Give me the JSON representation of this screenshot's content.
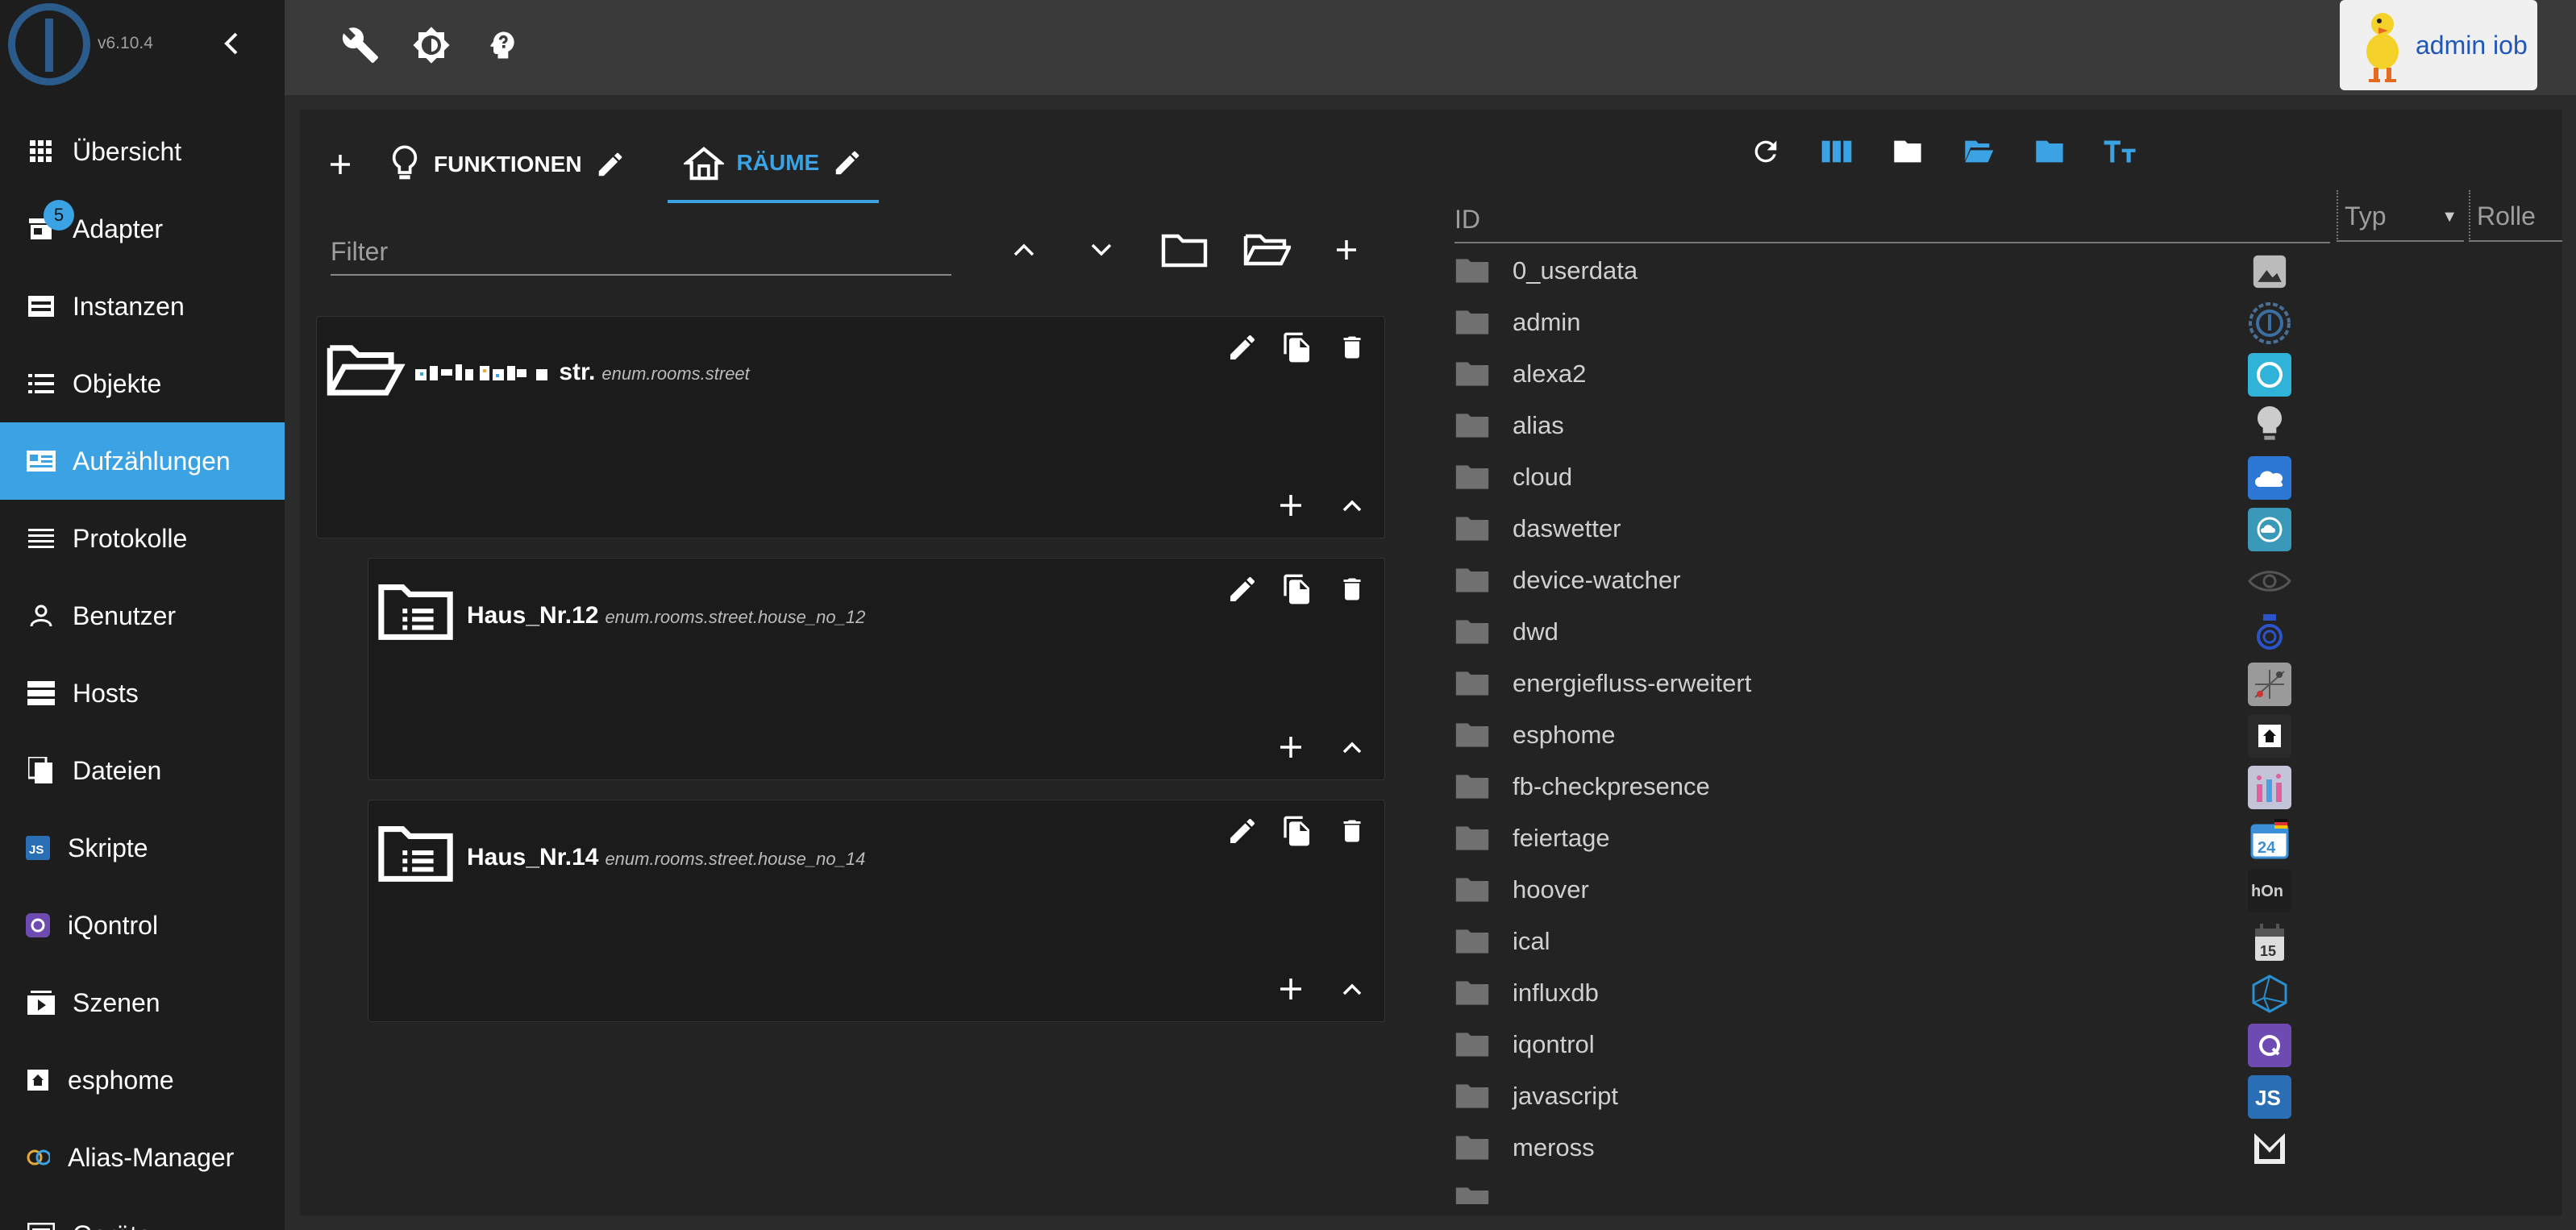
{
  "app": {
    "version": "v6.10.4"
  },
  "user": {
    "name": "admin iob"
  },
  "sidebar": {
    "items": [
      {
        "label": "Übersicht",
        "icon": "grid-icon"
      },
      {
        "label": "Adapter",
        "icon": "store-icon",
        "badge": "5"
      },
      {
        "label": "Instanzen",
        "icon": "instances-icon"
      },
      {
        "label": "Objekte",
        "icon": "list-icon"
      },
      {
        "label": "Aufzählungen",
        "icon": "enum-icon",
        "active": true
      },
      {
        "label": "Protokolle",
        "icon": "logs-icon"
      },
      {
        "label": "Benutzer",
        "icon": "person-icon"
      },
      {
        "label": "Hosts",
        "icon": "hosts-icon"
      },
      {
        "label": "Dateien",
        "icon": "files-icon"
      },
      {
        "label": "Skripte",
        "icon": "js-icon"
      },
      {
        "label": "iQontrol",
        "icon": "iqontrol-icon"
      },
      {
        "label": "Szenen",
        "icon": "scenes-icon"
      },
      {
        "label": "esphome",
        "icon": "esphome-icon"
      },
      {
        "label": "Alias-Manager",
        "icon": "alias-icon"
      },
      {
        "label": "Geräte",
        "icon": "devices-icon"
      }
    ]
  },
  "tabs": [
    {
      "label": "FUNKTIONEN"
    },
    {
      "label": "RÄUME",
      "active": true
    }
  ],
  "filter": {
    "placeholder": "Filter"
  },
  "cards": [
    {
      "title": "str.",
      "id": "enum.rooms.street"
    },
    {
      "title": "Haus_Nr.12",
      "id": "enum.rooms.street.house_no_12"
    },
    {
      "title": "Haus_Nr.14",
      "id": "enum.rooms.street.house_no_14"
    }
  ],
  "objects": {
    "columns": {
      "id": "ID",
      "type": "Typ",
      "role": "Rolle"
    },
    "rows": [
      {
        "name": "0_userdata",
        "icon": "image-icon"
      },
      {
        "name": "admin",
        "icon": "admin-icon"
      },
      {
        "name": "alexa2",
        "icon": "alexa-icon"
      },
      {
        "name": "alias",
        "icon": "bulb-icon"
      },
      {
        "name": "cloud",
        "icon": "cloud-icon"
      },
      {
        "name": "daswetter",
        "icon": "weather-icon"
      },
      {
        "name": "device-watcher",
        "icon": "eye-icon"
      },
      {
        "name": "dwd",
        "icon": "dwd-icon"
      },
      {
        "name": "energiefluss-erweitert",
        "icon": "energy-icon"
      },
      {
        "name": "esphome",
        "icon": "esphome-icon"
      },
      {
        "name": "fb-checkpresence",
        "icon": "presence-icon"
      },
      {
        "name": "feiertage",
        "icon": "calendar-24-icon"
      },
      {
        "name": "hoover",
        "icon": "hon-icon"
      },
      {
        "name": "ical",
        "icon": "calendar-15-icon"
      },
      {
        "name": "influxdb",
        "icon": "influx-icon"
      },
      {
        "name": "iqontrol",
        "icon": "iqontrol-icon"
      },
      {
        "name": "javascript",
        "icon": "js-icon"
      },
      {
        "name": "meross",
        "icon": "meross-icon"
      }
    ]
  },
  "colors": {
    "accent": "#3ba3e4",
    "sidebar": "#1d1d1d",
    "topbar": "#3a3a3a",
    "panel": "#232323"
  }
}
